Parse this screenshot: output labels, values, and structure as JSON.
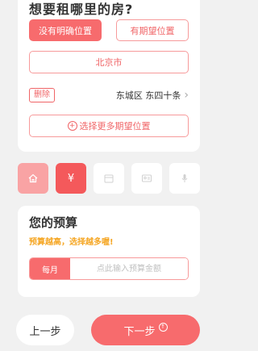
{
  "location": {
    "title": "想要租哪里的房?",
    "options": [
      "没有明确位置",
      "有期望位置"
    ],
    "city": "北京市",
    "delete_label": "删除",
    "district": "东城区 东四十条",
    "add_more": "选择更多期望位置"
  },
  "steps": [
    "home-icon",
    "yen-icon",
    "calendar-icon",
    "id-card-icon",
    "microphone-icon"
  ],
  "budget": {
    "title": "您的预算",
    "subtitle": "预算越高，选择越多喔!",
    "period": "每月",
    "placeholder": "点此输入预算金额"
  },
  "nav": {
    "prev": "上一步",
    "next": "下一步"
  },
  "colors": {
    "accent": "#f76b6d",
    "warning": "#f5a623"
  }
}
